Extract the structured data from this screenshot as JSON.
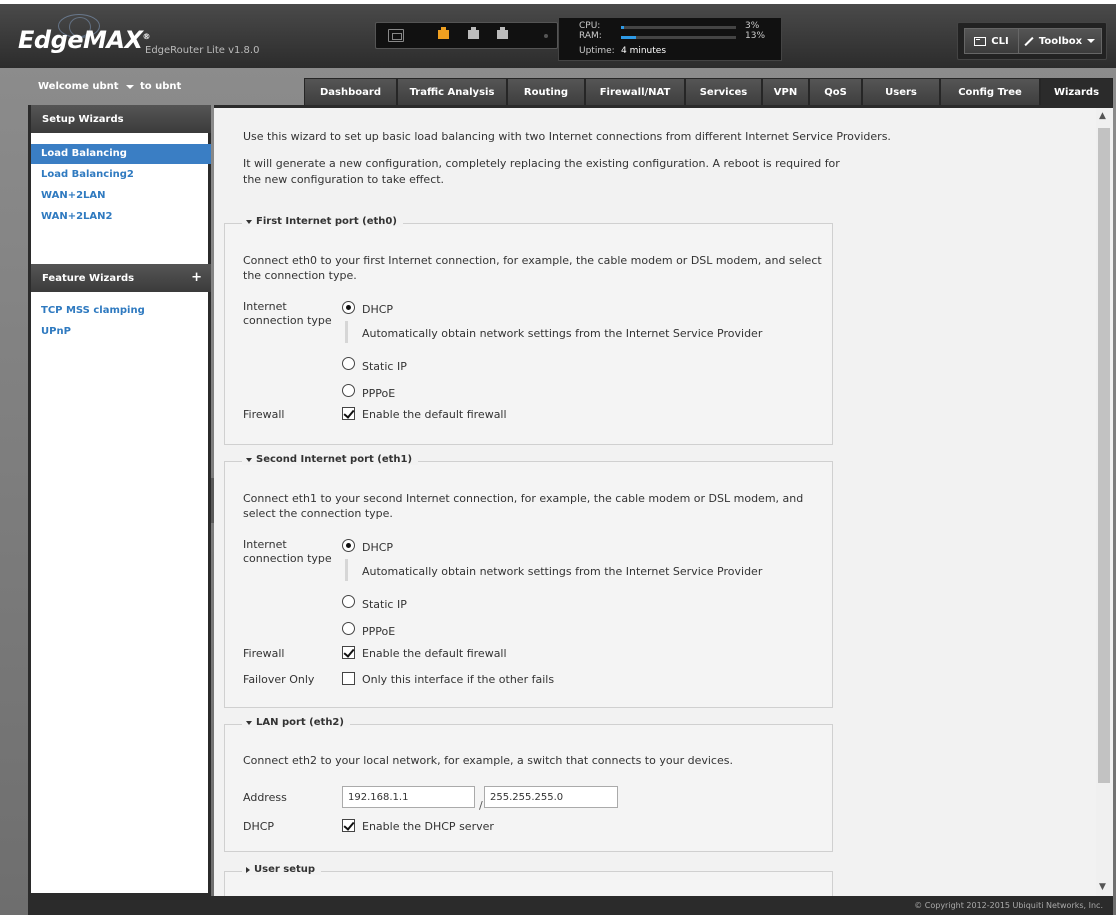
{
  "header": {
    "logo": "EdgeMAX",
    "logo_reg": "®",
    "product": "EdgeRouter Lite v1.8.0",
    "stats": {
      "cpu_label": "CPU:",
      "cpu_value": "3%",
      "cpu_fraction": 0.03,
      "ram_label": "RAM:",
      "ram_value": "13%",
      "ram_fraction": 0.13,
      "uptime_label": "Uptime:",
      "uptime_value": "4 minutes"
    },
    "cli_label": "CLI",
    "toolbox_label": "Toolbox"
  },
  "nav": {
    "welcome": "Welcome ubnt",
    "to_user": "to ubnt",
    "tabs": [
      "Dashboard",
      "Traffic Analysis",
      "Routing",
      "Firewall/NAT",
      "Services",
      "VPN",
      "QoS",
      "Users",
      "Config Tree",
      "Wizards"
    ],
    "active_tab": "Wizards"
  },
  "sidebar": {
    "setup_title": "Setup Wizards",
    "setup_items": [
      "Load Balancing",
      "Load Balancing2",
      "WAN+2LAN",
      "WAN+2LAN2"
    ],
    "active_item": "Load Balancing",
    "feature_title": "Feature Wizards",
    "feature_plus": "+",
    "feature_items": [
      "TCP MSS clamping",
      "UPnP"
    ]
  },
  "content": {
    "intro1": "Use this wizard to set up basic load balancing with two Internet connections from different Internet Service Providers.",
    "intro2": "It will generate a new configuration, completely replacing the existing configuration. A reboot is required for the new configuration to take effect.",
    "eth0": {
      "legend": "First Internet port (eth0)",
      "desc": "Connect eth0 to your first Internet connection, for example, the cable modem or DSL modem, and select the connection type.",
      "conn_label": "Internet connection type",
      "options": [
        "DHCP",
        "Static IP",
        "PPPoE"
      ],
      "selected": "DHCP",
      "hint": "Automatically obtain network settings from the Internet Service Provider",
      "firewall_label": "Firewall",
      "firewall_text": "Enable the default firewall",
      "firewall_checked": true
    },
    "eth1": {
      "legend": "Second Internet port (eth1)",
      "desc": "Connect eth1 to your second Internet connection, for example, the cable modem or DSL modem, and select the connection type.",
      "conn_label": "Internet connection type",
      "options": [
        "DHCP",
        "Static IP",
        "PPPoE"
      ],
      "selected": "DHCP",
      "hint": "Automatically obtain network settings from the Internet Service Provider",
      "firewall_label": "Firewall",
      "firewall_text": "Enable the default firewall",
      "firewall_checked": true,
      "failover_label": "Failover Only",
      "failover_text": "Only this interface if the other fails",
      "failover_checked": false
    },
    "lan": {
      "legend": "LAN port (eth2)",
      "desc": "Connect eth2 to your local network, for example, a switch that connects to your devices.",
      "address_label": "Address",
      "address_value": "192.168.1.1",
      "slash": "/",
      "netmask_value": "255.255.255.0",
      "dhcp_label": "DHCP",
      "dhcp_text": "Enable the DHCP server",
      "dhcp_checked": true
    },
    "user_setup": {
      "legend": "User setup"
    }
  },
  "footer": {
    "copyright": "© Copyright 2012-2015 Ubiquiti Networks, Inc."
  }
}
